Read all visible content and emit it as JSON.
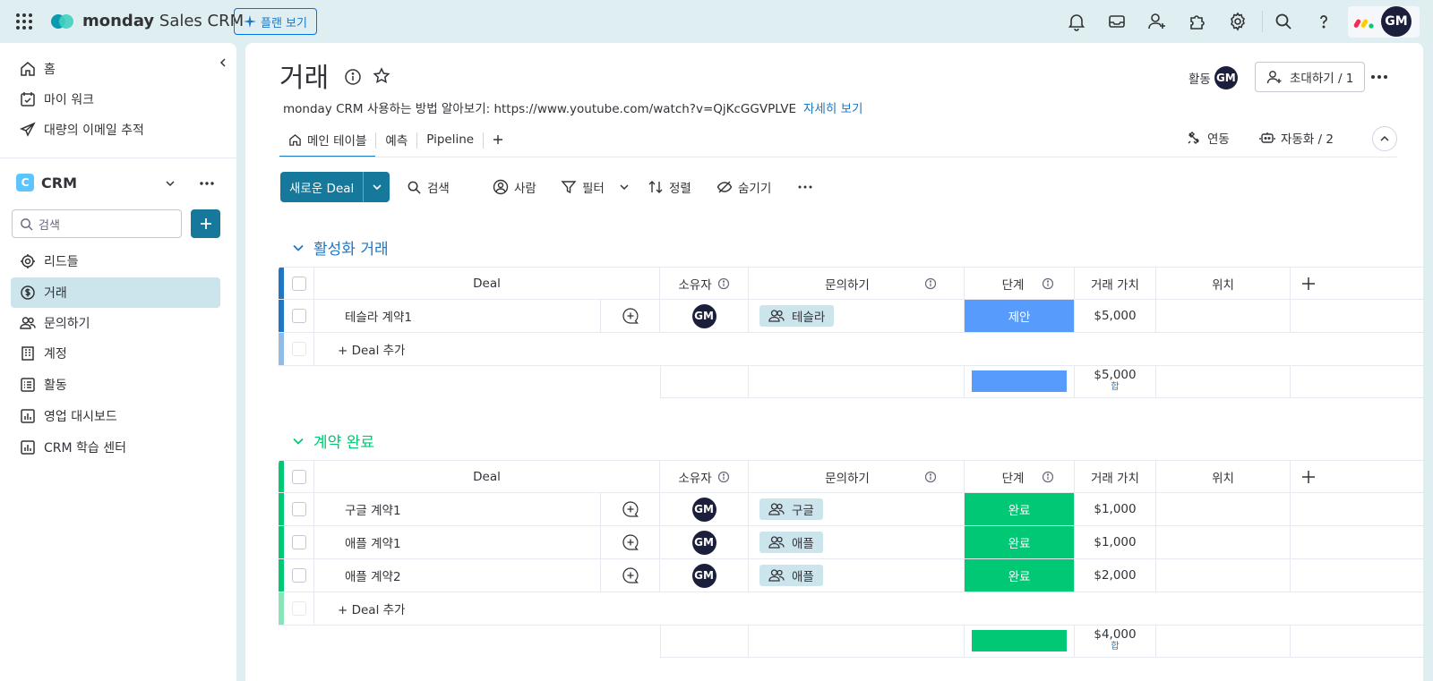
{
  "app": {
    "logo_brand": "monday",
    "logo_product": "Sales CRM",
    "plan_button": "플랜 보기",
    "avatar_initials": "GM"
  },
  "sidebar": {
    "top_items": [
      {
        "label": "홈",
        "icon": "home-icon"
      },
      {
        "label": "마이 워크",
        "icon": "my-work-icon"
      },
      {
        "label": "대량의 이메일 추적",
        "icon": "send-icon"
      }
    ],
    "workspace": {
      "badge": "C",
      "name": "CRM"
    },
    "search_placeholder": "검색",
    "boards": [
      {
        "label": "리드들",
        "icon": "target-icon"
      },
      {
        "label": "거래",
        "icon": "dollar-icon",
        "active": true
      },
      {
        "label": "문의하기",
        "icon": "contacts-icon"
      },
      {
        "label": "계정",
        "icon": "building-icon"
      },
      {
        "label": "활동",
        "icon": "list-icon"
      },
      {
        "label": "영업 대시보드",
        "icon": "dashboard-icon"
      },
      {
        "label": "CRM 학습 센터",
        "icon": "dashboard-icon"
      }
    ]
  },
  "board": {
    "title": "거래",
    "description": "monday CRM 사용하는 방법 알아보기: https://www.youtube.com/watch?v=QjKcGGVPLVE",
    "more_link": "자세히 보기",
    "activity_label": "활동",
    "invite_label": "초대하기 / 1",
    "tabs": [
      "메인 테이블",
      "예측",
      "Pipeline"
    ],
    "integrations_label": "연동",
    "automations_label": "자동화 / 2"
  },
  "toolbar": {
    "new_item": "새로운 Deal",
    "search": "검색",
    "person": "사람",
    "filter": "필터",
    "sort": "정렬",
    "hide": "숨기기"
  },
  "columns": {
    "deal": "Deal",
    "owner": "소유자",
    "contact": "문의하기",
    "stage": "단계",
    "value": "거래 가치",
    "location": "위치"
  },
  "add_row_label": "+ Deal 추가",
  "sum_label": "합",
  "groups": [
    {
      "title": "활성화 거래",
      "color": "#1f76c2",
      "rows": [
        {
          "deal": "테슬라 계약1",
          "owner": "GM",
          "contact": "테슬라",
          "stage": "제안",
          "stage_color": "#579bfc",
          "value": "$5,000"
        }
      ],
      "total": "$5,000",
      "summary_color": "#579bfc"
    },
    {
      "title": "계약 완료",
      "color": "#00c875",
      "rows": [
        {
          "deal": "구글 계약1",
          "owner": "GM",
          "contact": "구글",
          "stage": "완료",
          "stage_color": "#00c875",
          "value": "$1,000"
        },
        {
          "deal": "애플 계약1",
          "owner": "GM",
          "contact": "애플",
          "stage": "완료",
          "stage_color": "#00c875",
          "value": "$1,000"
        },
        {
          "deal": "애플 계약2",
          "owner": "GM",
          "contact": "애플",
          "stage": "완료",
          "stage_color": "#00c875",
          "value": "$2,000"
        }
      ],
      "total": "$4,000",
      "summary_color": "#00c875"
    }
  ]
}
